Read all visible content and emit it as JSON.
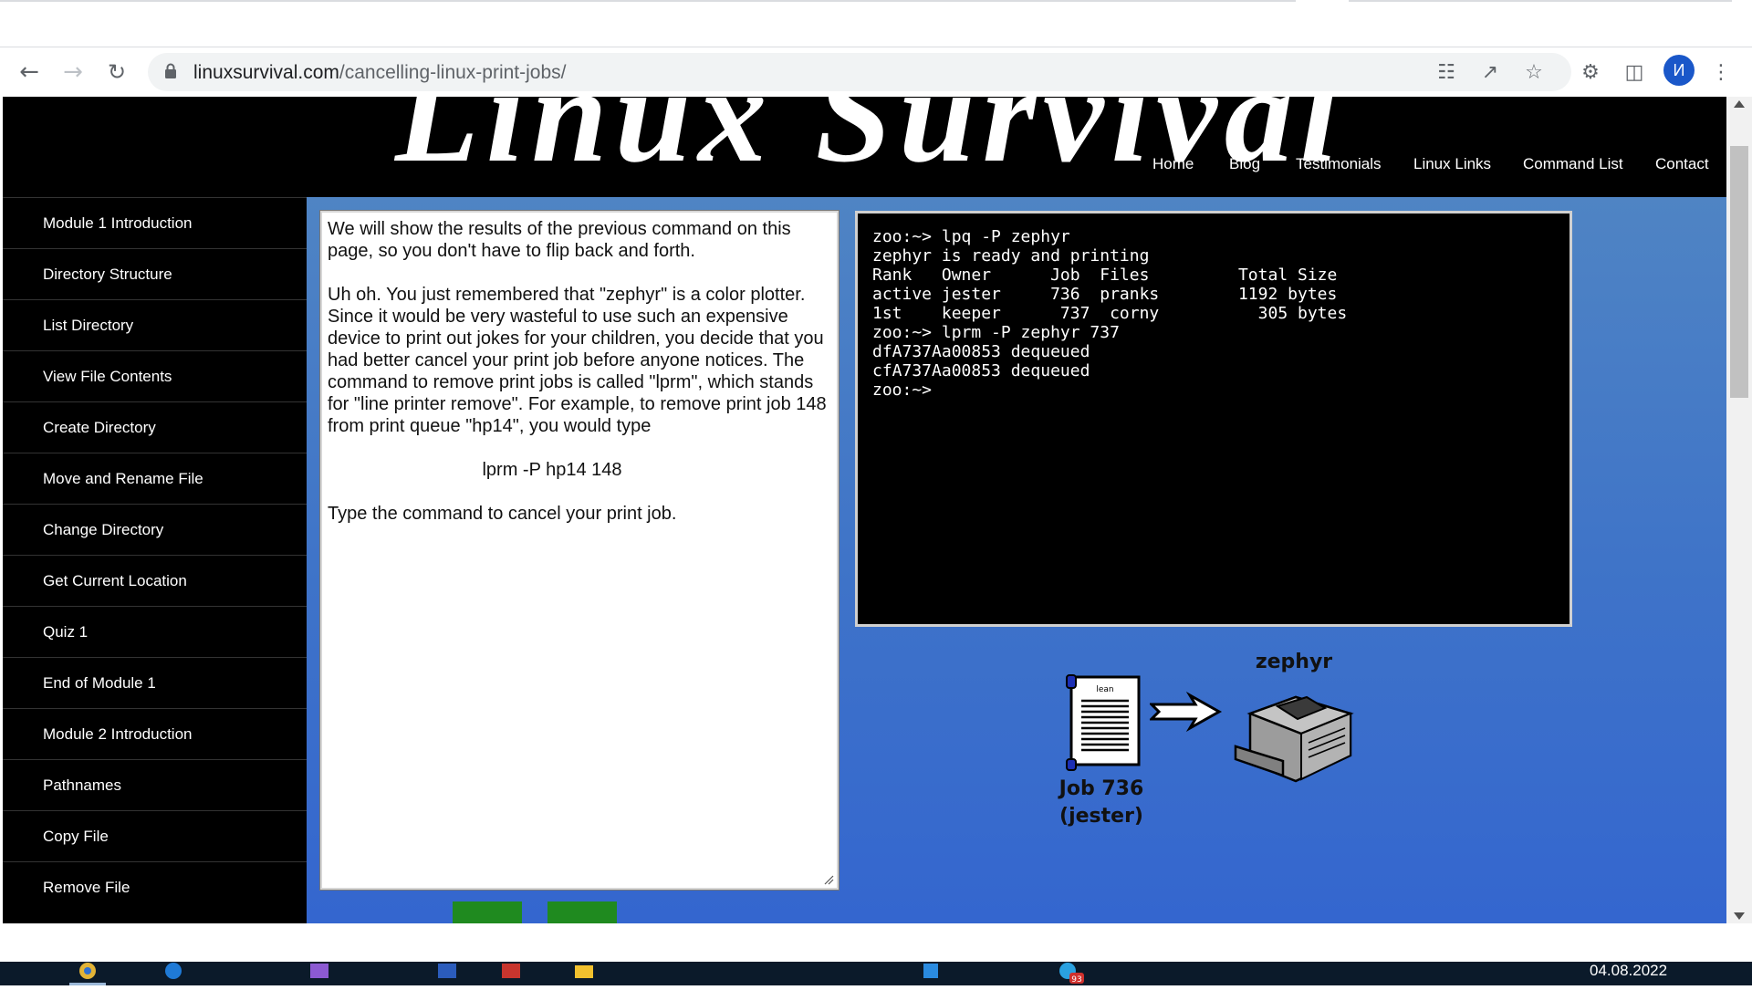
{
  "browser": {
    "url_domain": "linuxsurvival.com",
    "url_path": "/cancelling-linux-print-jobs/",
    "profile_initial": "И"
  },
  "site": {
    "logo": "Linux Survival",
    "nav": [
      "Home",
      "Blog",
      "Testimonials",
      "Linux Links",
      "Command List",
      "Contact"
    ]
  },
  "sidebar": {
    "items": [
      "Module 1 Introduction",
      "Directory Structure",
      "List Directory",
      "View File Contents",
      "Create Directory",
      "Move and Rename File",
      "Change Directory",
      "Get Current Location",
      "Quiz 1",
      "End of Module 1",
      "Module 2 Introduction",
      "Pathnames",
      "Copy File",
      "Remove File"
    ]
  },
  "lesson": {
    "p1": "We will show the results of the previous command on this page, so you don't have to flip back and forth.",
    "p2": "Uh oh. You just remembered that \"zephyr\" is a color plotter. Since it would be very wasteful to use such an expensive device to print out jokes for your children, you decide that you had better cancel your print job before anyone notices. The command to remove print jobs is called \"lprm\", which stands for \"line printer remove\". For example, to remove print job 148 from print queue \"hp14\", you would type",
    "example_cmd": "lprm -P hp14 148",
    "p3": "Type the command to cancel your print job."
  },
  "terminal": {
    "text": "zoo:~> lpq -P zephyr\nzephyr is ready and printing\nRank   Owner      Job  Files         Total Size\nactive jester     736  pranks        1192 bytes\n1st    keeper      737  corny          305 bytes\nzoo:~> lprm -P zephyr 737\ndfA737Aa00853 dequeued\ncfA737Aa00853 dequeued\nzoo:~>"
  },
  "diagram": {
    "printer_name": "zephyr",
    "job_label_line1": "Job 736",
    "job_label_line2": "(jester)",
    "scroll_label": "lean"
  },
  "taskbar": {
    "date": "04.08.2022",
    "badge": "93"
  }
}
